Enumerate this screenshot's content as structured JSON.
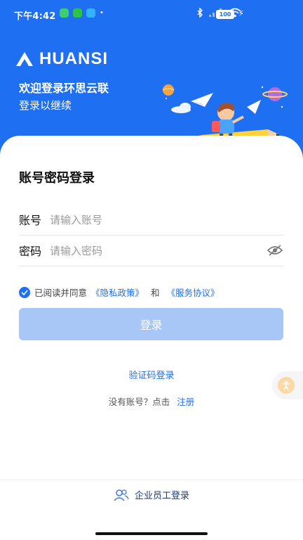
{
  "status_bar": {
    "time": "下午4:42",
    "battery": "100"
  },
  "brand": {
    "name": "HUANSI"
  },
  "hero": {
    "welcome": "欢迎登录环思云联",
    "subtitle": "登录以继续"
  },
  "form": {
    "title": "账号密码登录",
    "account_label": "账号",
    "account_placeholder": "请输入账号",
    "password_label": "密码",
    "password_placeholder": "请输入密码",
    "agree_text": "已阅读并同意",
    "privacy_link": "《隐私政策》",
    "and_text": "和",
    "service_link": "《服务协议》",
    "login_button": "登录",
    "sms_login": "验证码登录",
    "no_account": "没有账号？点击",
    "register_link": "注册"
  },
  "footer": {
    "enterprise_login": "企业员工登录"
  },
  "icons": [
    "wifi-icon",
    "bluetooth-icon",
    "eye-off-icon",
    "check-icon",
    "users-icon"
  ],
  "colors": {
    "primary": "#1f6ff2",
    "button_disabled": "#a8c7f6"
  }
}
